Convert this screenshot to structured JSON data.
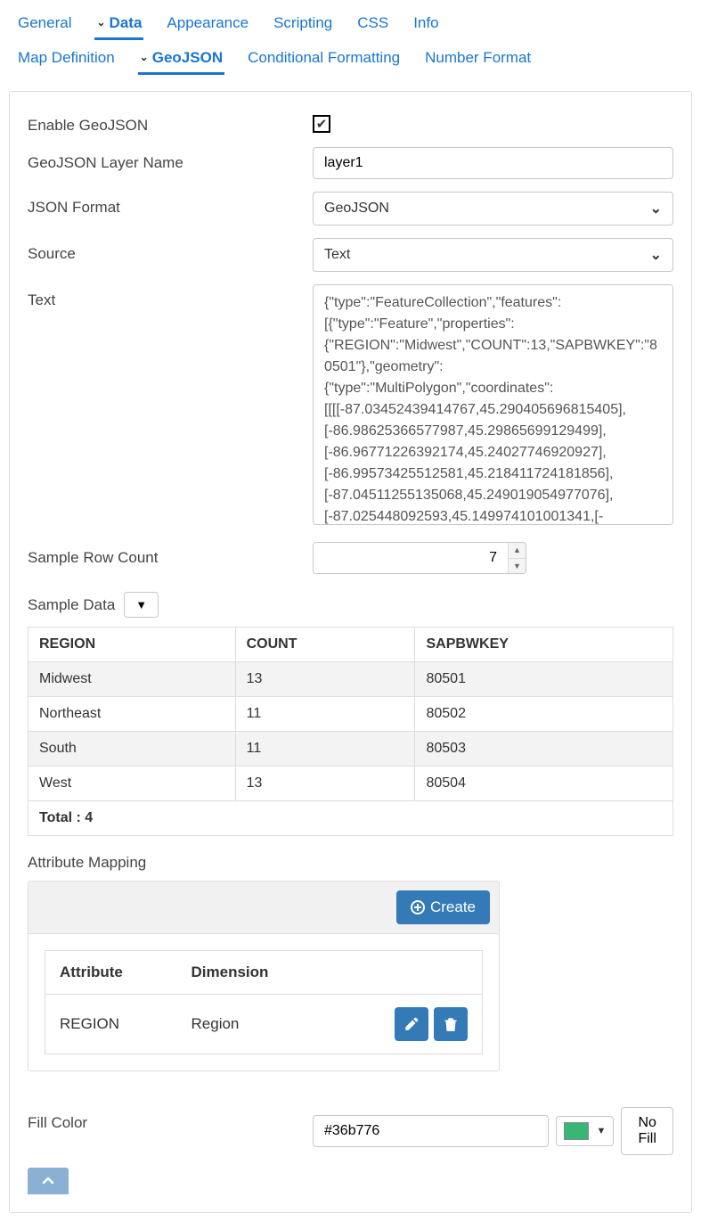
{
  "tabs_primary": [
    {
      "label": "General",
      "active": false,
      "has_chevron": false
    },
    {
      "label": "Data",
      "active": true,
      "has_chevron": true
    },
    {
      "label": "Appearance",
      "active": false,
      "has_chevron": false
    },
    {
      "label": "Scripting",
      "active": false,
      "has_chevron": false
    },
    {
      "label": "CSS",
      "active": false,
      "has_chevron": false
    },
    {
      "label": "Info",
      "active": false,
      "has_chevron": false
    }
  ],
  "tabs_secondary": [
    {
      "label": "Map Definition",
      "active": false,
      "has_chevron": false
    },
    {
      "label": "GeoJSON",
      "active": true,
      "has_chevron": true
    },
    {
      "label": "Conditional Formatting",
      "active": false,
      "has_chevron": false
    },
    {
      "label": "Number Format",
      "active": false,
      "has_chevron": false
    }
  ],
  "form": {
    "enable_label": "Enable GeoJSON",
    "enable_checked": true,
    "layer_name_label": "GeoJSON Layer Name",
    "layer_name_value": "layer1",
    "json_format_label": "JSON Format",
    "json_format_value": "GeoJSON",
    "source_label": "Source",
    "source_value": "Text",
    "text_label": "Text",
    "text_value": "{\"type\":\"FeatureCollection\",\"features\":[{\"type\":\"Feature\",\"properties\":{\"REGION\":\"Midwest\",\"COUNT\":13,\"SAPBWKEY\":\"80501\"},\"geometry\":{\"type\":\"MultiPolygon\",\"coordinates\":[[[[-87.03452439414767,45.290405696815405],[-86.98625366577987,45.29865699129499],[-86.96771226392174,45.24027746920927],[-86.99573425512581,45.218411724181856],[-87.04511255135068,45.249019054977076],[-87.025448092593,45.149974101001341,[-",
    "sample_count_label": "Sample Row Count",
    "sample_count_value": "7",
    "sample_data_label": "Sample Data",
    "attribute_mapping_label": "Attribute Mapping",
    "fill_color_label": "Fill Color"
  },
  "sample_table": {
    "headers": [
      "REGION",
      "COUNT",
      "SAPBWKEY"
    ],
    "rows": [
      [
        "Midwest",
        "13",
        "80501"
      ],
      [
        "Northeast",
        "11",
        "80502"
      ],
      [
        "South",
        "11",
        "80503"
      ],
      [
        "West",
        "13",
        "80504"
      ]
    ],
    "footer": "Total : 4"
  },
  "attr_mapping": {
    "create_label": "Create",
    "headers": [
      "Attribute",
      "Dimension"
    ],
    "rows": [
      {
        "attribute": "REGION",
        "dimension": "Region"
      }
    ]
  },
  "fill_color": {
    "value": "#36b776",
    "no_fill_label": "No Fill"
  }
}
